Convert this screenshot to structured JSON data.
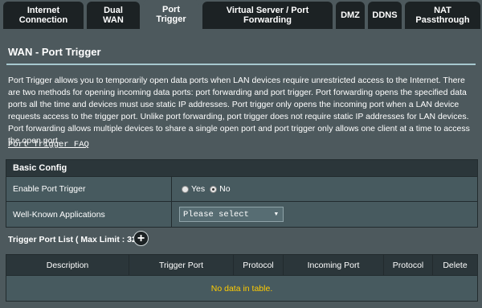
{
  "tabs": [
    {
      "label": "Internet\nConnection",
      "active": false
    },
    {
      "label": "Dual\nWAN",
      "active": false
    },
    {
      "label": "Port\nTrigger",
      "active": true
    },
    {
      "label": "Virtual Server / Port\nForwarding",
      "active": false
    },
    {
      "label": "DMZ",
      "active": false
    },
    {
      "label": "DDNS",
      "active": false
    },
    {
      "label": "NAT\nPassthrough",
      "active": false
    }
  ],
  "page": {
    "title": "WAN - Port Trigger",
    "description": "Port Trigger allows you to temporarily open data ports when LAN devices require unrestricted access to the Internet. There are two methods for opening incoming data ports: port forwarding and port trigger. Port forwarding opens the specified data ports all the time and devices must use static IP addresses. Port trigger only opens the incoming port when a LAN device requests access to the trigger port. Unlike port forwarding, port trigger does not require static IP addresses for LAN devices. Port forwarding allows multiple devices to share a single open port and port trigger only allows one client at a time to access the open port.",
    "faq_link": "Port Trigger FAQ"
  },
  "basic_config": {
    "header": "Basic Config",
    "enable_label": "Enable Port Trigger",
    "yes_label": "Yes",
    "no_label": "No",
    "enabled": "No",
    "apps_label": "Well-Known Applications",
    "apps_selected": "Please select"
  },
  "trigger_list": {
    "title": "Trigger Port List ( Max Limit : 32 )",
    "add_symbol": "+",
    "columns": [
      "Description",
      "Trigger Port",
      "Protocol",
      "Incoming Port",
      "Protocol",
      "Delete"
    ],
    "empty_text": "No data in table."
  },
  "colors": {
    "background": "#4d595d",
    "tab_inactive": "#1c2224",
    "header_row": "#2b363a",
    "empty_text": "#ffcc00"
  }
}
